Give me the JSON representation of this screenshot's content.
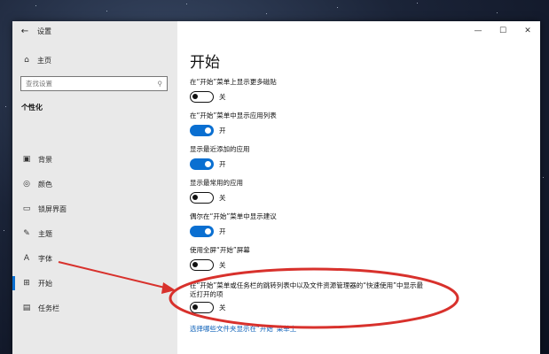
{
  "window": {
    "title": "设置"
  },
  "sidebar": {
    "home_label": "主页",
    "search_placeholder": "查找设置",
    "section_title": "个性化",
    "items": [
      {
        "label": "背景",
        "icon": "image-icon"
      },
      {
        "label": "颜色",
        "icon": "palette-icon"
      },
      {
        "label": "锁屏界面",
        "icon": "lockscreen-icon"
      },
      {
        "label": "主题",
        "icon": "theme-icon"
      },
      {
        "label": "字体",
        "icon": "font-icon"
      },
      {
        "label": "开始",
        "icon": "start-icon",
        "active": true
      },
      {
        "label": "任务栏",
        "icon": "taskbar-icon"
      }
    ]
  },
  "main": {
    "title": "开始",
    "settings": [
      {
        "label": "在“开始”菜单上显示更多磁贴",
        "state": "关",
        "on": false
      },
      {
        "label": "在“开始”菜单中显示应用列表",
        "state": "开",
        "on": true
      },
      {
        "label": "显示最近添加的应用",
        "state": "开",
        "on": true
      },
      {
        "label": "显示最常用的应用",
        "state": "关",
        "on": false
      },
      {
        "label": "偶尔在“开始”菜单中显示建议",
        "state": "开",
        "on": true
      },
      {
        "label": "使用全屏“开始”屏幕",
        "state": "关",
        "on": false
      },
      {
        "label": "在“开始”菜单或任务栏的跳转列表中以及文件资源管理器的“快速使用”中显示最近打开的项",
        "state": "关",
        "on": false
      }
    ],
    "link": "选择哪些文件夹显示在“开始”菜单上"
  },
  "colors": {
    "accent": "#0a6fd1",
    "annotation": "#d8312c"
  }
}
